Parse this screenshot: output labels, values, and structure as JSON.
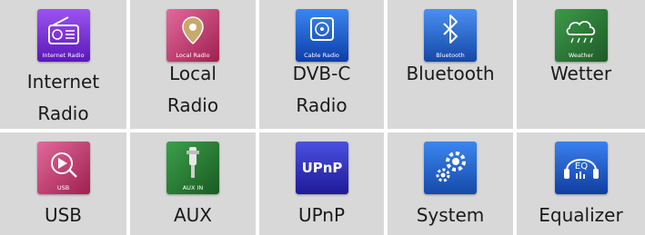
{
  "tiles": [
    {
      "label": "Internet\nRadio",
      "icon": "internet-radio-icon",
      "icon_text": "Internet Radio",
      "color": "#7a2bd6"
    },
    {
      "label": "Local\nRadio",
      "icon": "local-radio-icon",
      "icon_text": "Local Radio",
      "color": "#c43a6b"
    },
    {
      "label": "DVB-C\nRadio",
      "icon": "cable-radio-icon",
      "icon_text": "Cable Radio",
      "color": "#1f64d8"
    },
    {
      "label": "Bluetooth",
      "icon": "bluetooth-icon",
      "icon_text": "Bluetooth",
      "color": "#2c74d6"
    },
    {
      "label": "Wetter",
      "icon": "weather-icon",
      "icon_text": "Weather",
      "color": "#2e7a3a"
    },
    {
      "label": "USB",
      "icon": "usb-icon",
      "icon_text": "USB",
      "color": "#c43a6b"
    },
    {
      "label": "AUX",
      "icon": "aux-in-icon",
      "icon_text": "AUX IN",
      "color": "#2f7a2f"
    },
    {
      "label": "UPnP",
      "icon": "upnp-icon",
      "icon_text": "UPnP",
      "color": "#3a2fbf"
    },
    {
      "label": "System",
      "icon": "system-gears-icon",
      "icon_text": "",
      "color": "#2d68c8"
    },
    {
      "label": "Equalizer",
      "icon": "equalizer-icon",
      "icon_text": "EQ",
      "color": "#1d5ac8"
    }
  ]
}
